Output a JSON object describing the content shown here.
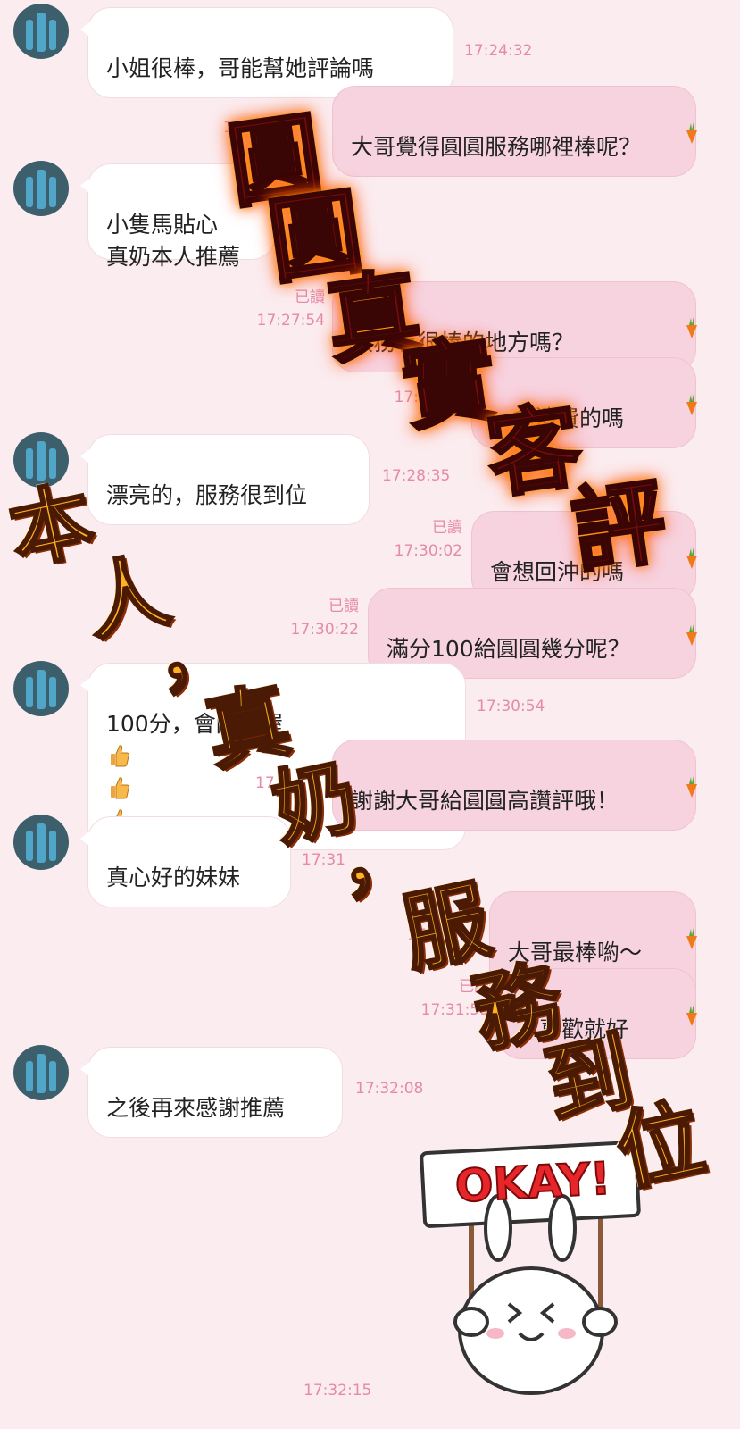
{
  "read_label": "已讀",
  "colors": {
    "background": "#fbecef",
    "incoming_bubble": "#ffffff",
    "outgoing_bubble": "#f7d3e0",
    "timestamp": "#e58aa7"
  },
  "messages": [
    {
      "side": "in",
      "text": "小姐很棒，哥能幫她評論嗎",
      "time": "17:24:32"
    },
    {
      "side": "out",
      "text": "大哥覺得圓圓服務哪裡棒呢？",
      "time": "17"
    },
    {
      "side": "in",
      "text": "小隻馬貼心\n真奶本人推薦",
      "time": ""
    },
    {
      "side": "out",
      "text": "服務有很棒的地方嗎？",
      "time": "17:27:54",
      "read": true
    },
    {
      "side": "out",
      "text": "…會消費的嗎",
      "time": "17:28:10",
      "read": true
    },
    {
      "side": "in",
      "text": "漂亮的，服務很到位",
      "time": "17:28:35"
    },
    {
      "side": "out",
      "text": "會想回沖的嗎",
      "time": "17:30:02",
      "read": true
    },
    {
      "side": "out",
      "text": "滿分100給圓圓幾分呢？",
      "time": "17:30:22",
      "read": true
    },
    {
      "side": "in",
      "text": "100分，會回沖喔",
      "time": "17:30:54"
    },
    {
      "side": "out",
      "text": "謝謝大哥給圓圓高讚評哦！",
      "time": "17"
    },
    {
      "side": "in",
      "text": "真心好的妹妹",
      "time": "17:31"
    },
    {
      "side": "out",
      "text": "大哥最棒喲～",
      "time": "17"
    },
    {
      "side": "out",
      "text": "…喜歡就好",
      "time": "17:31:59",
      "read": true
    },
    {
      "side": "in",
      "text": "之後再來感謝推薦",
      "time": "17:32:08"
    }
  ],
  "sticker": {
    "sign_text": "OKAY!",
    "time": "17:32:15"
  },
  "overlays": {
    "headline_fire": [
      "圓",
      "圓",
      "真",
      "實",
      "客",
      "評"
    ],
    "slogan_1": [
      "本",
      "人",
      "，"
    ],
    "slogan_2": [
      "真",
      "奶",
      "，"
    ],
    "slogan_3": [
      "服",
      "務",
      "到",
      "位"
    ]
  }
}
